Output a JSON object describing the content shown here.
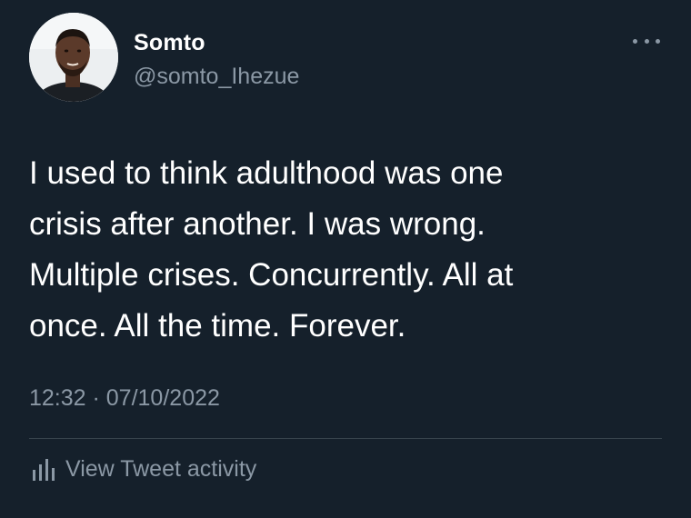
{
  "tweet": {
    "author": {
      "display_name": "Somto",
      "handle": "@somto_Ihezue",
      "avatar_icon": "profile-photo"
    },
    "text": "I used to think adulthood was one\ncrisis after another. I was wrong.\nMultiple crises. Concurrently. All at\nonce. All the time. Forever.",
    "timestamp": "12:32 · 07/10/2022",
    "activity_label": "View Tweet activity",
    "activity_icon": "bar-chart-icon",
    "more_icon": "more-options-icon"
  },
  "colors": {
    "background": "#15202b",
    "primary_text": "#ffffff",
    "secondary_text": "#8b98a5",
    "divider": "#38444d"
  }
}
